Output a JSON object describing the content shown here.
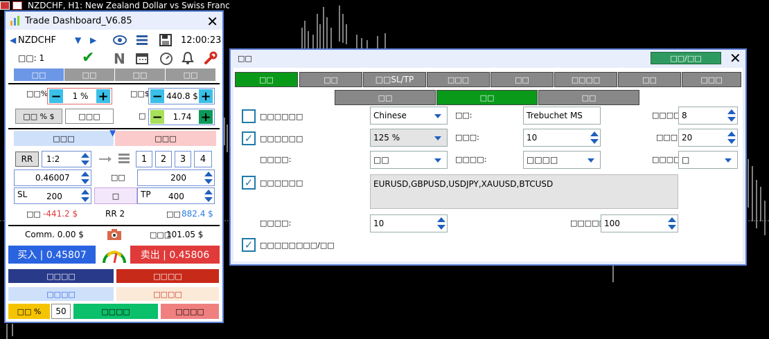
{
  "topbar": {
    "chart_title": "NZDCHF, H1:  New Zealand Dollar vs Swiss Franc"
  },
  "colors": {
    "accent_blue": "#5b7fd6",
    "buy_blue": "#2a63e0",
    "sell_red": "#e03a3a",
    "green_active": "#0a9a1a",
    "gray_tab": "#8a8a8a"
  },
  "dashboard": {
    "title": "Trade Dashboard_V6.85",
    "symbol": "NZDCHF",
    "time": "12:00:23",
    "count_label": "□□: 1",
    "icons": [
      "eye-icon",
      "lines-icon",
      "save-icon",
      "check-icon",
      "n-icon",
      "calendar-icon",
      "timer-icon",
      "bell-icon",
      "wrench-icon"
    ],
    "tabs": [
      "□□",
      "□□",
      "□□",
      "□□"
    ],
    "risk_pct_label": "□□%",
    "risk_pct_value": "1 %",
    "risk_usd_label": "□□$",
    "risk_usd_value": "440.8 $",
    "mode_btn": "□□ % $",
    "mode_btn2": "□□□",
    "lot_label": "□",
    "lot_value": "1.74",
    "side_left": "□□□",
    "side_right": "□□□",
    "rr_label": "RR",
    "rr_value": "1:2",
    "multipliers": [
      "1",
      "2",
      "3",
      "4"
    ],
    "entry_price": "0.46007",
    "points_label": "□□",
    "points_value": "200",
    "sl_label": "SL",
    "sl_value": "200",
    "mid_btn": "□",
    "tp_label": "TP",
    "tp_value": "400",
    "loss_label": "□□",
    "loss_value": "-441.2 $",
    "rr_summary": "RR 2",
    "profit_label": "□□",
    "profit_value": "882.4 $",
    "comm": "Comm. 0.00 $",
    "spread_label": "□□□",
    "spread_value": "101.05 $",
    "buy_label": "买入 | 0.45807",
    "sell_label": "卖出 | 0.45806",
    "btn_row1_left": "□□□□",
    "btn_row1_right": "□□□□",
    "btn_row2_left": "□□□□",
    "btn_row2_right": "□□□□",
    "pct_btn": "□□ %",
    "pct_value": "50",
    "btn_row3_mid": "□□□□",
    "btn_row3_right": "□□□□"
  },
  "settings": {
    "title": "□□",
    "header_btn": "□□/□□",
    "tabs": [
      "□□",
      "□□",
      "□□SL/TP",
      "□□□",
      "□□",
      "□□□□",
      "□□",
      "□□□"
    ],
    "subtabs": [
      "□□",
      "□□",
      "□□"
    ],
    "rows": {
      "r1_label": "□□□□□□",
      "language": "Chinese",
      "font_label": "□□:",
      "font_value": "Trebuchet MS",
      "fontsize_label": "□□□□:",
      "fontsize_value": "8",
      "r2_label": "□□□□□□",
      "scale_value": "125 %",
      "r2_field_label": "□□□:",
      "r2_field_value": "10",
      "r2_right_label": "□□□:",
      "r2_right_value": "20",
      "r3_label": "□□□□:",
      "r3_dd1": "□□",
      "r3_mid_label": "□□□□:",
      "r3_dd2": "□□□□",
      "r3_right_label": "□□□□:",
      "r3_dd3": "□",
      "r4_label": "□□□□□□",
      "symbols": "EURUSD,GBPUSD,USDJPY,XAUUSD,BTCUSD",
      "r5_label": "□□□□:",
      "r5_value": "10",
      "r5_right_label": "□□□□□:",
      "r5_right_value": "100",
      "r6_label": "□□□□□□□□/□□"
    }
  }
}
